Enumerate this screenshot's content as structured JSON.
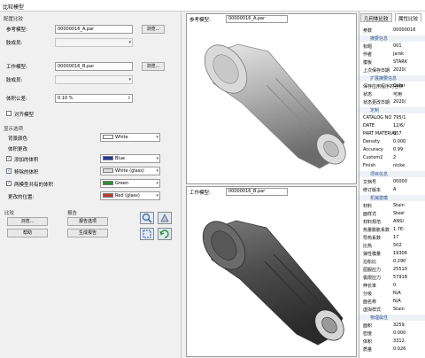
{
  "window": {
    "title": "比较模型"
  },
  "left": {
    "config_section": "配置比较",
    "ref_model_label": "参考模型:",
    "ref_model_value": "00000016_A.par",
    "ref_browse": "浏览...",
    "ref_pos_label": "肢成员:",
    "work_model_label": "工作模型:",
    "work_model_value": "00000016_B.par",
    "work_browse": "浏览...",
    "work_pos_label": "肢成员:",
    "volume_tol_label": "体积公差:",
    "volume_tol_value": "0.10 %",
    "align_label": "对齐模型",
    "display_section": "显示选项",
    "bg_color_label": "背景颜色",
    "bg_color_value": "White",
    "volume_change_label": "体积更改",
    "added_label": "添加的体积",
    "added_value": "Blue",
    "removed_label": "移除的体积",
    "removed_value": "White (glass)",
    "both_label": "两模型共有的体积",
    "both_value": "Green",
    "changed_pos_label": "更改的位置:",
    "changed_pos_value": "Red (glass)",
    "compare_section": "比较",
    "browse_btn": "浏览...",
    "help_btn": "帮助",
    "report_section": "报告",
    "report_options_btn": "报告选项",
    "generate_report_btn": "生成报告"
  },
  "viewports": {
    "ref_label": "参考模型:",
    "ref_value": "00000016_A.par",
    "work_label": "工作模型:",
    "work_value": "00000016_B.par"
  },
  "right": {
    "tabs": [
      "几何体比较",
      "属性比较"
    ],
    "rows": [
      {
        "k": "参数",
        "v": "00000016",
        "cat": false
      },
      {
        "k": "摘要信息",
        "v": "",
        "cat": true
      },
      {
        "k": "标题",
        "v": "001",
        "cat": false
      },
      {
        "k": "作者",
        "v": "jarsk",
        "cat": false
      },
      {
        "k": "模板",
        "v": "STARK",
        "cat": false
      },
      {
        "k": "上次保存日期",
        "v": "2020/",
        "cat": false
      },
      {
        "k": "扩展摘要信息",
        "v": "",
        "cat": true
      },
      {
        "k": "保存应用程序的名称",
        "v": "Catar",
        "cat": false
      },
      {
        "k": "状态",
        "v": "可用",
        "cat": false
      },
      {
        "k": "状态更改日期",
        "v": "2020/",
        "cat": false
      },
      {
        "k": "定制",
        "v": "",
        "cat": true
      },
      {
        "k": "CATALOG NO",
        "v": "795/1",
        "cat": false
      },
      {
        "k": "DATE",
        "v": "12/6/",
        "cat": false
      },
      {
        "k": "PART MATERIAL",
        "v": "657",
        "cat": false
      },
      {
        "k": "Density",
        "v": "0.000",
        "cat": false
      },
      {
        "k": "Accuracy",
        "v": "0.99",
        "cat": false
      },
      {
        "k": "Custom2",
        "v": "2",
        "cat": false
      },
      {
        "k": "Finish",
        "v": "nicke",
        "cat": false
      },
      {
        "k": "项目信息",
        "v": "",
        "cat": true
      },
      {
        "k": "文档号",
        "v": "00000",
        "cat": false
      },
      {
        "k": "修订版本",
        "v": "A",
        "cat": false
      },
      {
        "k": "机械建模",
        "v": "",
        "cat": true
      },
      {
        "k": "材料",
        "v": "Stain",
        "cat": false
      },
      {
        "k": "面样式",
        "v": "Steel",
        "cat": false
      },
      {
        "k": "材料规范",
        "v": "ANSI",
        "cat": false
      },
      {
        "k": "热量膨胀系数",
        "v": "1.7E-",
        "cat": false
      },
      {
        "k": "导热系数",
        "v": "17",
        "cat": false
      },
      {
        "k": "比热",
        "v": "502",
        "cat": false
      },
      {
        "k": "弹性模量",
        "v": "19306",
        "cat": false
      },
      {
        "k": "泊松比",
        "v": "0.290",
        "cat": false
      },
      {
        "k": "屈服应力",
        "v": "25510",
        "cat": false
      },
      {
        "k": "极限应力",
        "v": "57918",
        "cat": false
      },
      {
        "k": "伸长率",
        "v": "0",
        "cat": false
      },
      {
        "k": "分级",
        "v": "N/A",
        "cat": false
      },
      {
        "k": "面名称",
        "v": "N/A",
        "cat": false
      },
      {
        "k": "虚拟样式",
        "v": "Stain",
        "cat": false
      },
      {
        "k": "物理属性",
        "v": "",
        "cat": true
      },
      {
        "k": "面积",
        "v": "3259.",
        "cat": false
      },
      {
        "k": "密度",
        "v": "0.000",
        "cat": false
      },
      {
        "k": "体积",
        "v": "3312.",
        "cat": false
      },
      {
        "k": "质量",
        "v": "0.026",
        "cat": false
      }
    ]
  },
  "colors": {
    "added": "#1f3c9c",
    "removed": "#e0e0e0",
    "both": "#2f8f2f",
    "changed": "#c0392b"
  }
}
